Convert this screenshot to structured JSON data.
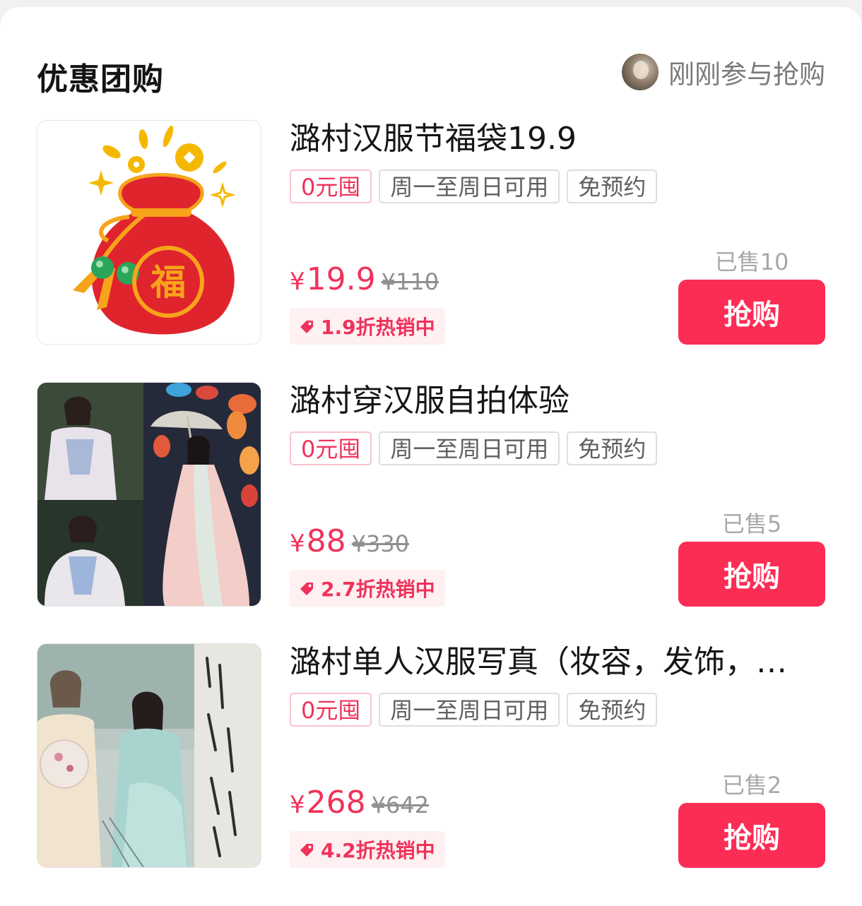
{
  "header": {
    "title": "优惠团购",
    "recent_link": "刚刚参与抢购"
  },
  "items": [
    {
      "title": "潞村汉服节福袋19.9",
      "tags": [
        "0元囤",
        "周一至周日可用",
        "免预约"
      ],
      "currency": "¥",
      "price": "19.9",
      "original_price": "¥110",
      "discount": "1.9折热销中",
      "sold": "已售10",
      "button": "抢购",
      "image": "lucky-bag-image"
    },
    {
      "title": "潞村穿汉服自拍体验",
      "tags": [
        "0元囤",
        "周一至周日可用",
        "免预约"
      ],
      "currency": "¥",
      "price": "88",
      "original_price": "¥330",
      "discount": "2.7折热销中",
      "sold": "已售5",
      "button": "抢购",
      "image": "hanfu-selfie-photo"
    },
    {
      "title": "潞村单人汉服写真（妆容，发饰，…",
      "tags": [
        "0元囤",
        "周一至周日可用",
        "免预约"
      ],
      "currency": "¥",
      "price": "268",
      "original_price": "¥642",
      "discount": "4.2折热销中",
      "sold": "已售2",
      "button": "抢购",
      "image": "hanfu-portrait-photo"
    }
  ],
  "colors": {
    "accent": "#fc2d55",
    "price": "#f0325b",
    "discount_bg": "#fff0f2"
  }
}
